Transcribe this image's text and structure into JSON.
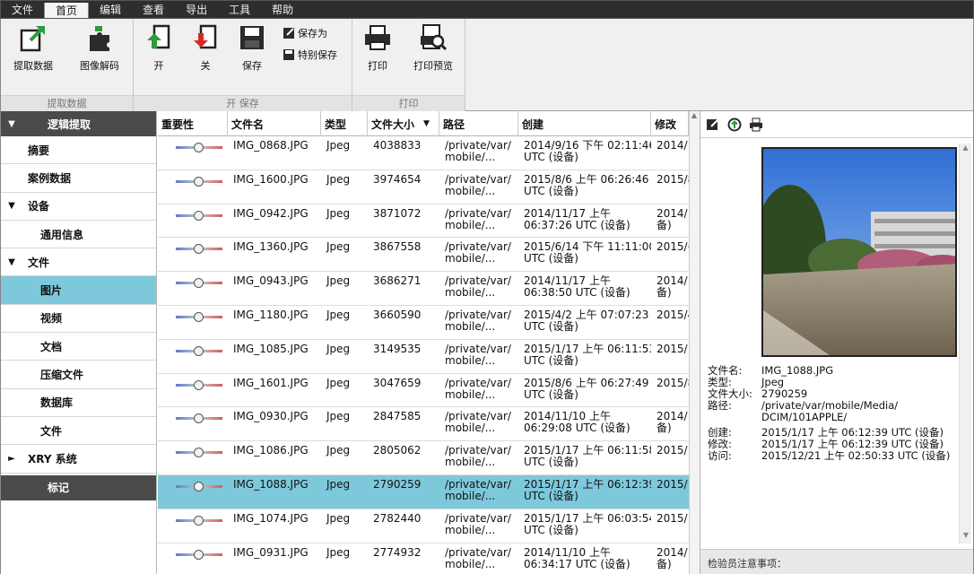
{
  "menubar": {
    "items": [
      {
        "label": "文件",
        "active": false
      },
      {
        "label": "首页",
        "active": true
      },
      {
        "label": "编辑",
        "active": false
      },
      {
        "label": "查看",
        "active": false
      },
      {
        "label": "导出",
        "active": false
      },
      {
        "label": "工具",
        "active": false
      },
      {
        "label": "帮助",
        "active": false
      }
    ]
  },
  "ribbon": {
    "extract": {
      "extract_label": "提取数据",
      "decode_label": "图像解码",
      "group_label": "提取数据"
    },
    "openSave": {
      "open_label": "开",
      "close_label": "关",
      "save_label": "保存",
      "saveas_label": "保存为",
      "special_save_label": "特别保存",
      "group_label": "开 保存"
    },
    "print": {
      "print_label": "打印",
      "preview_label": "打印预览",
      "group_label": "打印"
    }
  },
  "nav": {
    "header": "逻辑提取",
    "items": [
      {
        "label": "摘要",
        "indent": 1,
        "arrow": "",
        "selected": false
      },
      {
        "label": "案例数据",
        "indent": 1,
        "arrow": "",
        "selected": false
      },
      {
        "label": "设备",
        "indent": 0,
        "arrow": "▼",
        "selected": false
      },
      {
        "label": "通用信息",
        "indent": 2,
        "arrow": "",
        "selected": false
      },
      {
        "label": "文件",
        "indent": 0,
        "arrow": "▼",
        "selected": false
      },
      {
        "label": "图片",
        "indent": 2,
        "arrow": "",
        "selected": true
      },
      {
        "label": "视频",
        "indent": 2,
        "arrow": "",
        "selected": false
      },
      {
        "label": "文档",
        "indent": 2,
        "arrow": "",
        "selected": false
      },
      {
        "label": "压缩文件",
        "indent": 2,
        "arrow": "",
        "selected": false
      },
      {
        "label": "数据库",
        "indent": 2,
        "arrow": "",
        "selected": false
      },
      {
        "label": "文件",
        "indent": 2,
        "arrow": "",
        "selected": false
      },
      {
        "label": "XRY 系统",
        "indent": 0,
        "arrow": "►",
        "selected": false
      }
    ],
    "footer": "标记"
  },
  "table": {
    "columns": [
      "重要性",
      "文件名",
      "类型",
      "文件大小",
      "路径",
      "创建",
      "修改"
    ],
    "sort_indicator": "▼",
    "rows": [
      {
        "name": "IMG_0868.JPG",
        "type": "Jpeg",
        "size": "4038833",
        "path1": "/private/var/",
        "path2": "mobile/...",
        "created1": "2014/9/16 下午 02:11:46",
        "created2": "UTC (设备)",
        "modified1": "2014/!",
        "modified2": "",
        "selected": false
      },
      {
        "name": "IMG_1600.JPG",
        "type": "Jpeg",
        "size": "3974654",
        "path1": "/private/var/",
        "path2": "mobile/...",
        "created1": "2015/8/6 上午 06:26:46",
        "created2": "UTC (设备)",
        "modified1": "2015/8",
        "modified2": "",
        "selected": false
      },
      {
        "name": "IMG_0942.JPG",
        "type": "Jpeg",
        "size": "3871072",
        "path1": "/private/var/",
        "path2": "mobile/...",
        "created1": "2014/11/17 上午",
        "created2": "06:37:26 UTC (设备)",
        "modified1": "2014/",
        "modified2": "备)",
        "selected": false
      },
      {
        "name": "IMG_1360.JPG",
        "type": "Jpeg",
        "size": "3867558",
        "path1": "/private/var/",
        "path2": "mobile/...",
        "created1": "2015/6/14 下午 11:11:00",
        "created2": "UTC (设备)",
        "modified1": "2015/(",
        "modified2": "",
        "selected": false
      },
      {
        "name": "IMG_0943.JPG",
        "type": "Jpeg",
        "size": "3686271",
        "path1": "/private/var/",
        "path2": "mobile/...",
        "created1": "2014/11/17 上午",
        "created2": "06:38:50 UTC (设备)",
        "modified1": "2014/",
        "modified2": "备)",
        "selected": false
      },
      {
        "name": "IMG_1180.JPG",
        "type": "Jpeg",
        "size": "3660590",
        "path1": "/private/var/",
        "path2": "mobile/...",
        "created1": "2015/4/2 上午 07:07:23",
        "created2": "UTC (设备)",
        "modified1": "2015/4",
        "modified2": "",
        "selected": false
      },
      {
        "name": "IMG_1085.JPG",
        "type": "Jpeg",
        "size": "3149535",
        "path1": "/private/var/",
        "path2": "mobile/...",
        "created1": "2015/1/17 上午 06:11:53",
        "created2": "UTC (设备)",
        "modified1": "2015/",
        "modified2": "",
        "selected": false
      },
      {
        "name": "IMG_1601.JPG",
        "type": "Jpeg",
        "size": "3047659",
        "path1": "/private/var/",
        "path2": "mobile/...",
        "created1": "2015/8/6 上午 06:27:49",
        "created2": "UTC (设备)",
        "modified1": "2015/8",
        "modified2": "",
        "selected": false
      },
      {
        "name": "IMG_0930.JPG",
        "type": "Jpeg",
        "size": "2847585",
        "path1": "/private/var/",
        "path2": "mobile/...",
        "created1": "2014/11/10 上午",
        "created2": "06:29:08 UTC (设备)",
        "modified1": "2014/",
        "modified2": "备)",
        "selected": false
      },
      {
        "name": "IMG_1086.JPG",
        "type": "Jpeg",
        "size": "2805062",
        "path1": "/private/var/",
        "path2": "mobile/...",
        "created1": "2015/1/17 上午 06:11:58",
        "created2": "UTC (设备)",
        "modified1": "2015/",
        "modified2": "",
        "selected": false
      },
      {
        "name": "IMG_1088.JPG",
        "type": "Jpeg",
        "size": "2790259",
        "path1": "/private/var/",
        "path2": "mobile/...",
        "created1": "2015/1/17 上午 06:12:39",
        "created2": "UTC (设备)",
        "modified1": "2015/",
        "modified2": "",
        "selected": true
      },
      {
        "name": "IMG_1074.JPG",
        "type": "Jpeg",
        "size": "2782440",
        "path1": "/private/var/",
        "path2": "mobile/...",
        "created1": "2015/1/17 上午 06:03:54",
        "created2": "UTC (设备)",
        "modified1": "2015/",
        "modified2": "",
        "selected": false
      },
      {
        "name": "IMG_0931.JPG",
        "type": "Jpeg",
        "size": "2774932",
        "path1": "/private/var/",
        "path2": "mobile/...",
        "created1": "2014/11/10 上午",
        "created2": "06:34:17 UTC (设备)",
        "modified1": "2014/",
        "modified2": "备)",
        "selected": false
      }
    ]
  },
  "details": {
    "filename_key": "文件名:",
    "filename": "IMG_1088.JPG",
    "type_key": "类型:",
    "type": "Jpeg",
    "size_key": "文件大小:",
    "size": "2790259",
    "path_key": "路径:",
    "path1": "/private/var/mobile/Media/",
    "path2": "DCIM/101APPLE/",
    "created_key": "创建:",
    "created": "2015/1/17 上午 06:12:39 UTC (设备)",
    "modified_key": "修改:",
    "modified": "2015/1/17 上午 06:12:39 UTC (设备)",
    "accessed_key": "访问:",
    "accessed": "2015/12/21 上午 02:50:33 UTC (设备)",
    "notes_label": "检验员注意事项："
  },
  "colors": {
    "selection": "#7ec8dc",
    "menubar": "#2e2e2e",
    "navheader": "#4b4b4b"
  }
}
